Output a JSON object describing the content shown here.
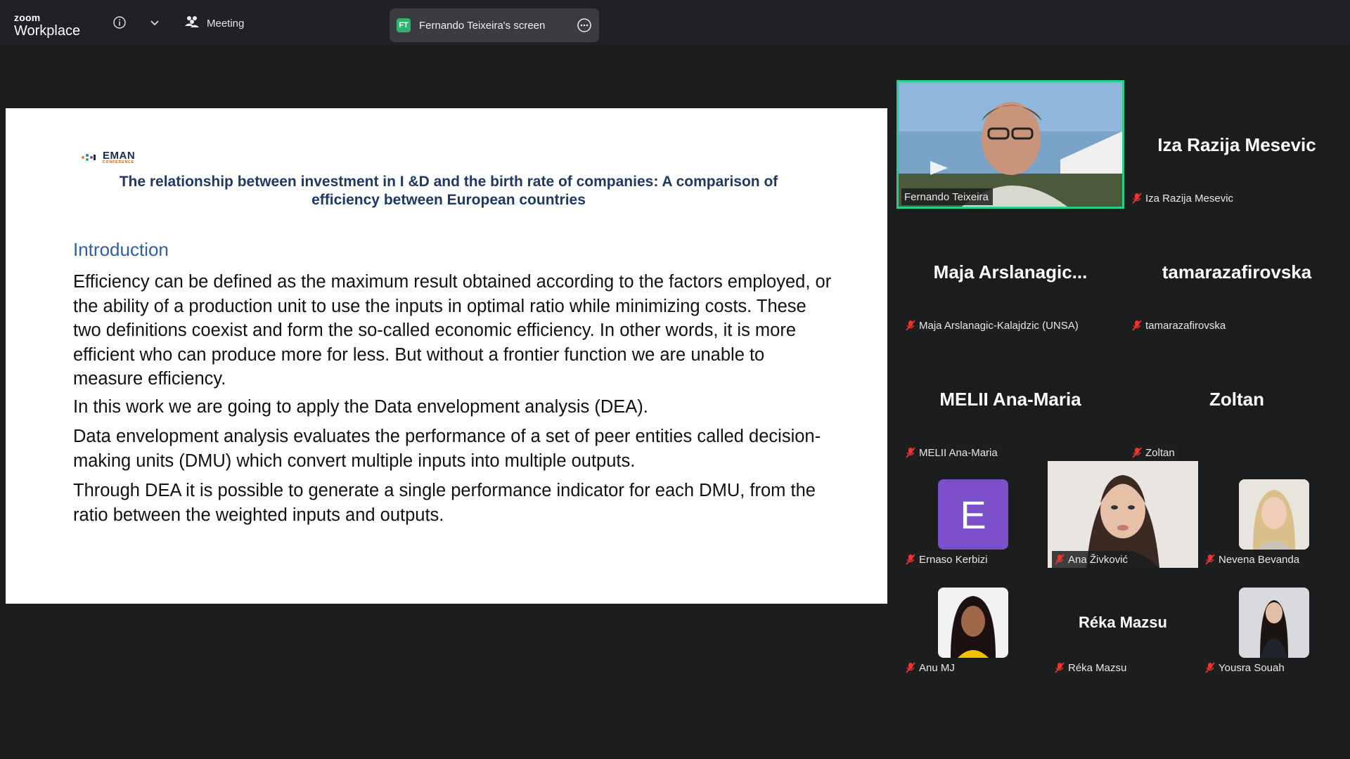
{
  "app": {
    "brand_small": "zoom",
    "brand_large": "Workplace",
    "meeting_label": "Meeting",
    "share_badge": "FT",
    "share_label": "Fernando Teixeira's screen"
  },
  "colors": {
    "accent_active": "#23d18b",
    "avatar_purple": "#7b4fc9",
    "title_blue": "#1f3864",
    "heading_blue": "#2e5fa3"
  },
  "slide": {
    "logo_text": "EMAN",
    "logo_sub": "CONFERENCE",
    "title_line1": "The relationship between investment in I &D and the birth rate of companies: A comparison of",
    "title_line2": "efficiency between European countries",
    "heading": "Introduction",
    "paragraph1": "Efficiency can be defined as the maximum result obtained according to the factors employed, or the ability of a production unit to use the inputs in optimal ratio while minimizing costs. These two definitions coexist and form the so-called economic efficiency. In other words, it is more efficient who can produce more for less. But without a frontier function we are unable to measure efficiency.",
    "paragraph2": "In this work we are going to apply the Data envelopment analysis (DEA).",
    "paragraph3": "Data envelopment analysis evaluates the performance of a set of peer entities called decision-making units (DMU) which convert multiple inputs into multiple outputs.",
    "paragraph4": "Through DEA it is possible to generate a single performance indicator for each DMU, from the ratio between the weighted inputs and outputs."
  },
  "participants": {
    "fernando": {
      "tag": "Fernando Teixeira"
    },
    "iza": {
      "big": "Iza Razija Mesevic",
      "tag": "Iza Razija Mesevic"
    },
    "maja": {
      "big": "Maja  Arslanagic...",
      "tag": "Maja Arslanagic-Kalajdzic (UNSA)"
    },
    "tamara": {
      "big": "tamarazafirovska",
      "tag": "tamarazafirovska"
    },
    "melii": {
      "big": "MELII Ana-Maria",
      "tag": "MELII Ana-Maria"
    },
    "zoltan": {
      "big": "Zoltan",
      "tag": "Zoltan"
    },
    "ernaso": {
      "initial": "E",
      "tag": "Ernaso Kerbizi"
    },
    "ana": {
      "tag": "Ana Živković"
    },
    "nevena": {
      "tag": "Nevena Bevanda"
    },
    "anu": {
      "tag": "Anu MJ"
    },
    "reka": {
      "big": "Réka Mazsu",
      "tag": "Réka Mazsu"
    },
    "yousra": {
      "tag": "Yousra Souah"
    }
  },
  "icons": {
    "info": "info-icon",
    "chevron": "chevron-down-icon",
    "meeting": "participants-icon",
    "more": "more-options-icon",
    "mic": "mic-muted-icon"
  }
}
